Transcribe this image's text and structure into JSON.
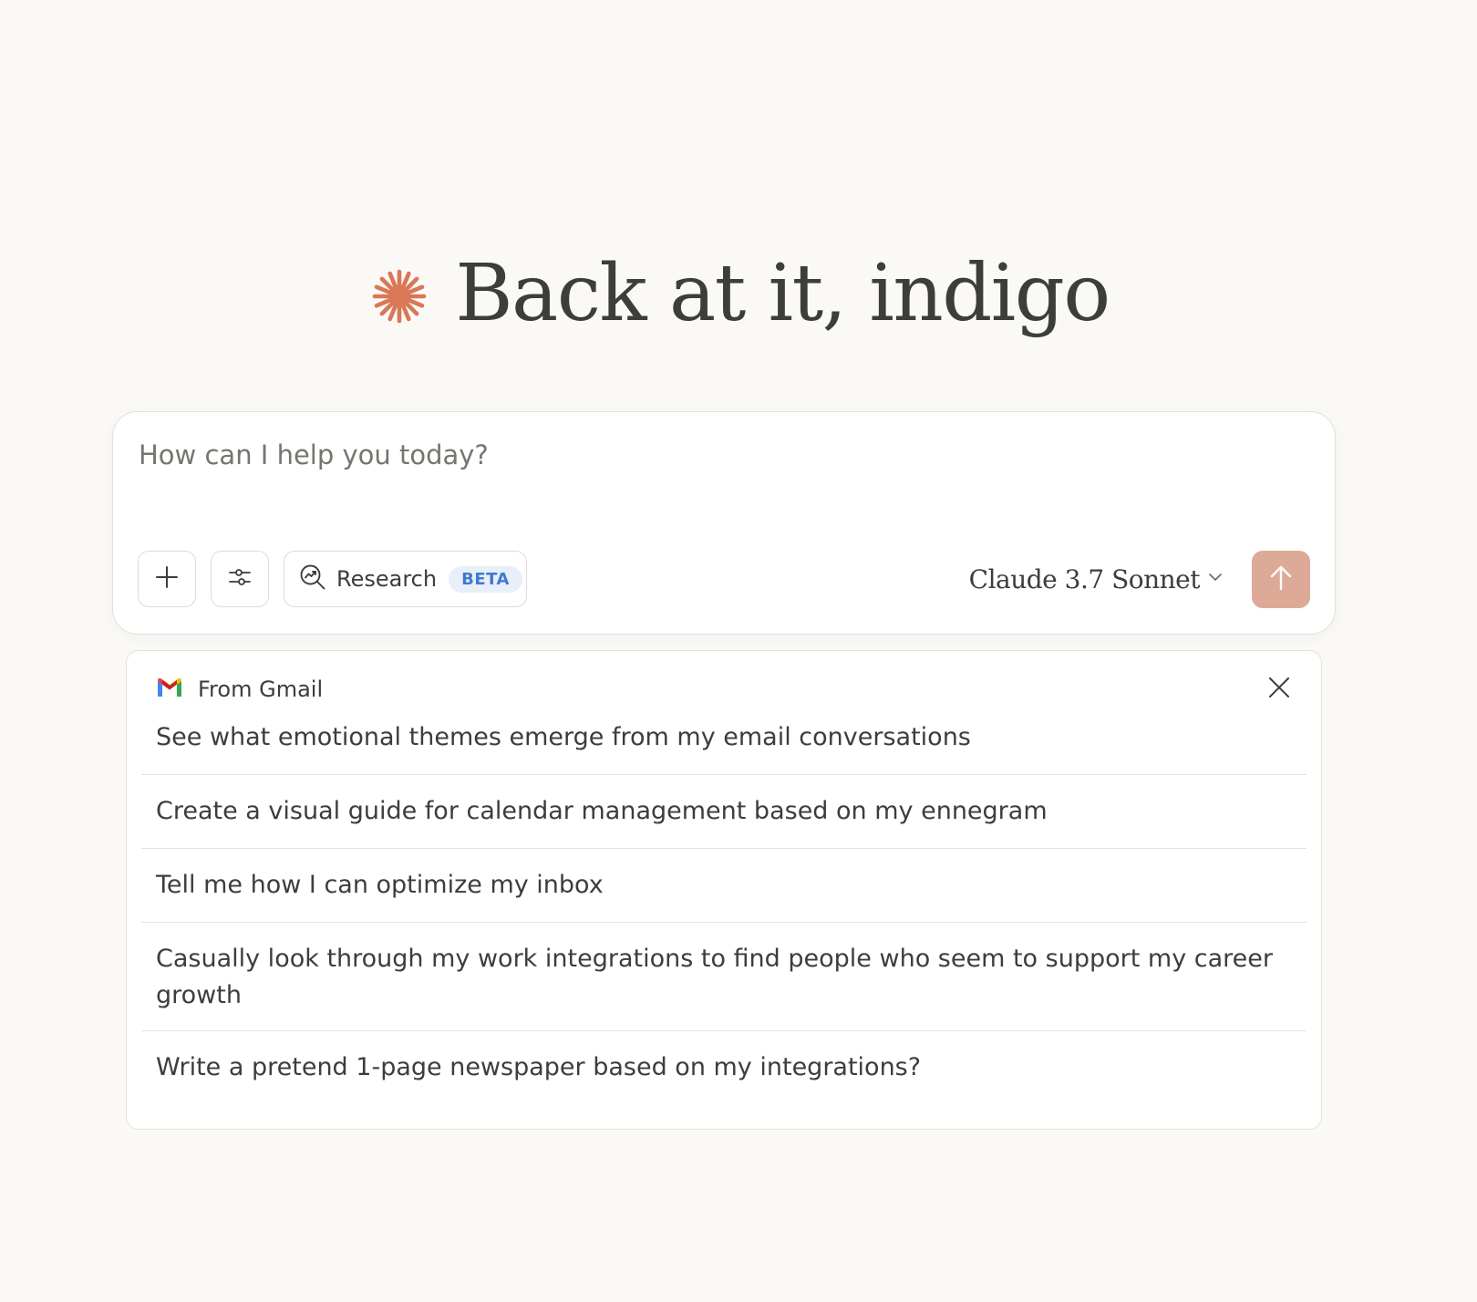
{
  "greeting": {
    "title": "Back at it, indigo",
    "icon": "claude-spark-icon",
    "accent_color": "#d97757"
  },
  "composer": {
    "placeholder": "How can I help you today?",
    "buttons": {
      "add": "plus-icon",
      "tools": "sliders-icon"
    },
    "research": {
      "label": "Research",
      "badge": "BETA"
    },
    "model": {
      "name": "Claude 3.7 Sonnet"
    },
    "send_color": "#deaa98"
  },
  "suggestions": {
    "source": "From Gmail",
    "items": [
      "See what emotional themes emerge from my email conversations",
      "Create a visual guide for calendar management based on my ennegram",
      "Tell me how I can optimize my inbox",
      "Casually look through my work integrations to find people who seem to support my career growth",
      "Write a pretend 1-page newspaper based on my integrations?"
    ]
  }
}
